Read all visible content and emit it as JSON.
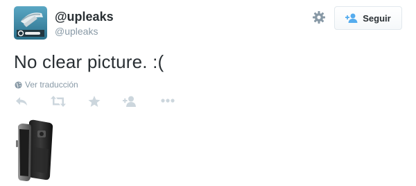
{
  "header": {
    "display_name": "@upleaks",
    "username": "@upleaks",
    "follow_label": "Seguir",
    "icons": {
      "avatar": "avatar-logo",
      "settings": "gear-icon",
      "follow": "follow-user-icon"
    }
  },
  "tweet": {
    "text": "No clear picture. :("
  },
  "translate": {
    "label": "Ver traducción",
    "icon": "globe-icon"
  },
  "actions": [
    {
      "name": "reply-icon"
    },
    {
      "name": "retweet-icon"
    },
    {
      "name": "favorite-icon"
    },
    {
      "name": "follow-user-icon"
    },
    {
      "name": "more-icon"
    }
  ],
  "media": {
    "description_icon": "phone-photo-thumbnail"
  },
  "colors": {
    "text": "#292f33",
    "muted": "#8899a6",
    "icon": "#ccd6dd",
    "accent": "#55acee"
  }
}
